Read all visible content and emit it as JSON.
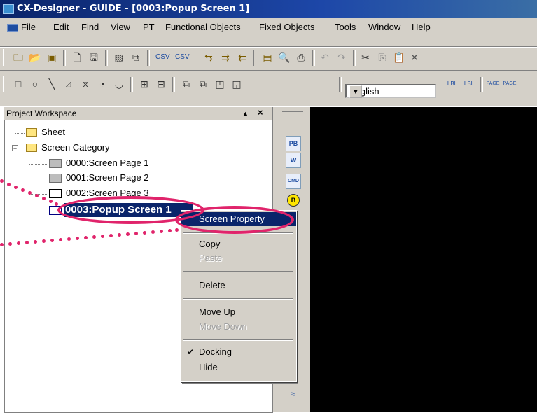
{
  "window": {
    "title": "CX-Designer - GUIDE - [0003:Popup Screen 1]"
  },
  "menubar": {
    "items": [
      "File",
      "Edit",
      "Find",
      "View",
      "PT",
      "Functional Objects",
      "Fixed Objects",
      "Tools",
      "Window",
      "Help"
    ]
  },
  "toolbar": {
    "language_value": "English",
    "icons_row1": [
      "new-folder-icon",
      "open-icon",
      "open-project-icon",
      "new-page-icon",
      "save-icon",
      "hatch-icon",
      "copy-icon",
      "csv-export-icon",
      "csv-import-icon",
      "transfer-icon",
      "transfer-to-icon",
      "transfer-from-icon",
      "document-icon",
      "print-preview-icon",
      "print-icon",
      "undo-icon",
      "redo-icon",
      "cut-icon",
      "copy-icon-2",
      "paste-icon",
      "delete-icon"
    ],
    "icons_row2": [
      "rectangle-icon",
      "circle-icon",
      "line-icon",
      "polyline-icon",
      "polygon-icon",
      "sector-icon",
      "arc-icon",
      "align-icon",
      "align-2-icon",
      "group-icon",
      "ungroup-icon",
      "front-icon",
      "back-icon",
      "label-prev-icon",
      "label-next-icon",
      "page-prev-icon",
      "page-next-icon"
    ]
  },
  "workspace": {
    "title": "Project Workspace",
    "tree": [
      {
        "label": "Sheet",
        "type": "folder"
      },
      {
        "label": "Screen Category",
        "type": "folder",
        "expanded": true
      },
      {
        "label": "0000:Screen Page 1",
        "type": "page"
      },
      {
        "label": "0001:Screen Page 2",
        "type": "page"
      },
      {
        "label": "0002:Screen Page 3",
        "type": "page"
      },
      {
        "label": "0003:Popup Screen 1",
        "type": "page",
        "selected": true
      }
    ]
  },
  "palette": {
    "buttons": [
      "PB",
      "W",
      "CMD",
      "B"
    ]
  },
  "context_menu": {
    "items": [
      {
        "label": "Screen Property",
        "highlighted": true
      },
      {
        "label": "Copy"
      },
      {
        "label": "Paste",
        "disabled": true
      },
      {
        "label": "Delete"
      },
      {
        "label": "Move Up"
      },
      {
        "label": "Move Down",
        "disabled": true
      },
      {
        "label": "Docking",
        "checked": true
      },
      {
        "label": "Hide"
      }
    ]
  },
  "colors": {
    "title_bar": "#0a246a",
    "highlight": "#0a246a",
    "callout": "#e0246b",
    "editor_bg": "#000000"
  }
}
